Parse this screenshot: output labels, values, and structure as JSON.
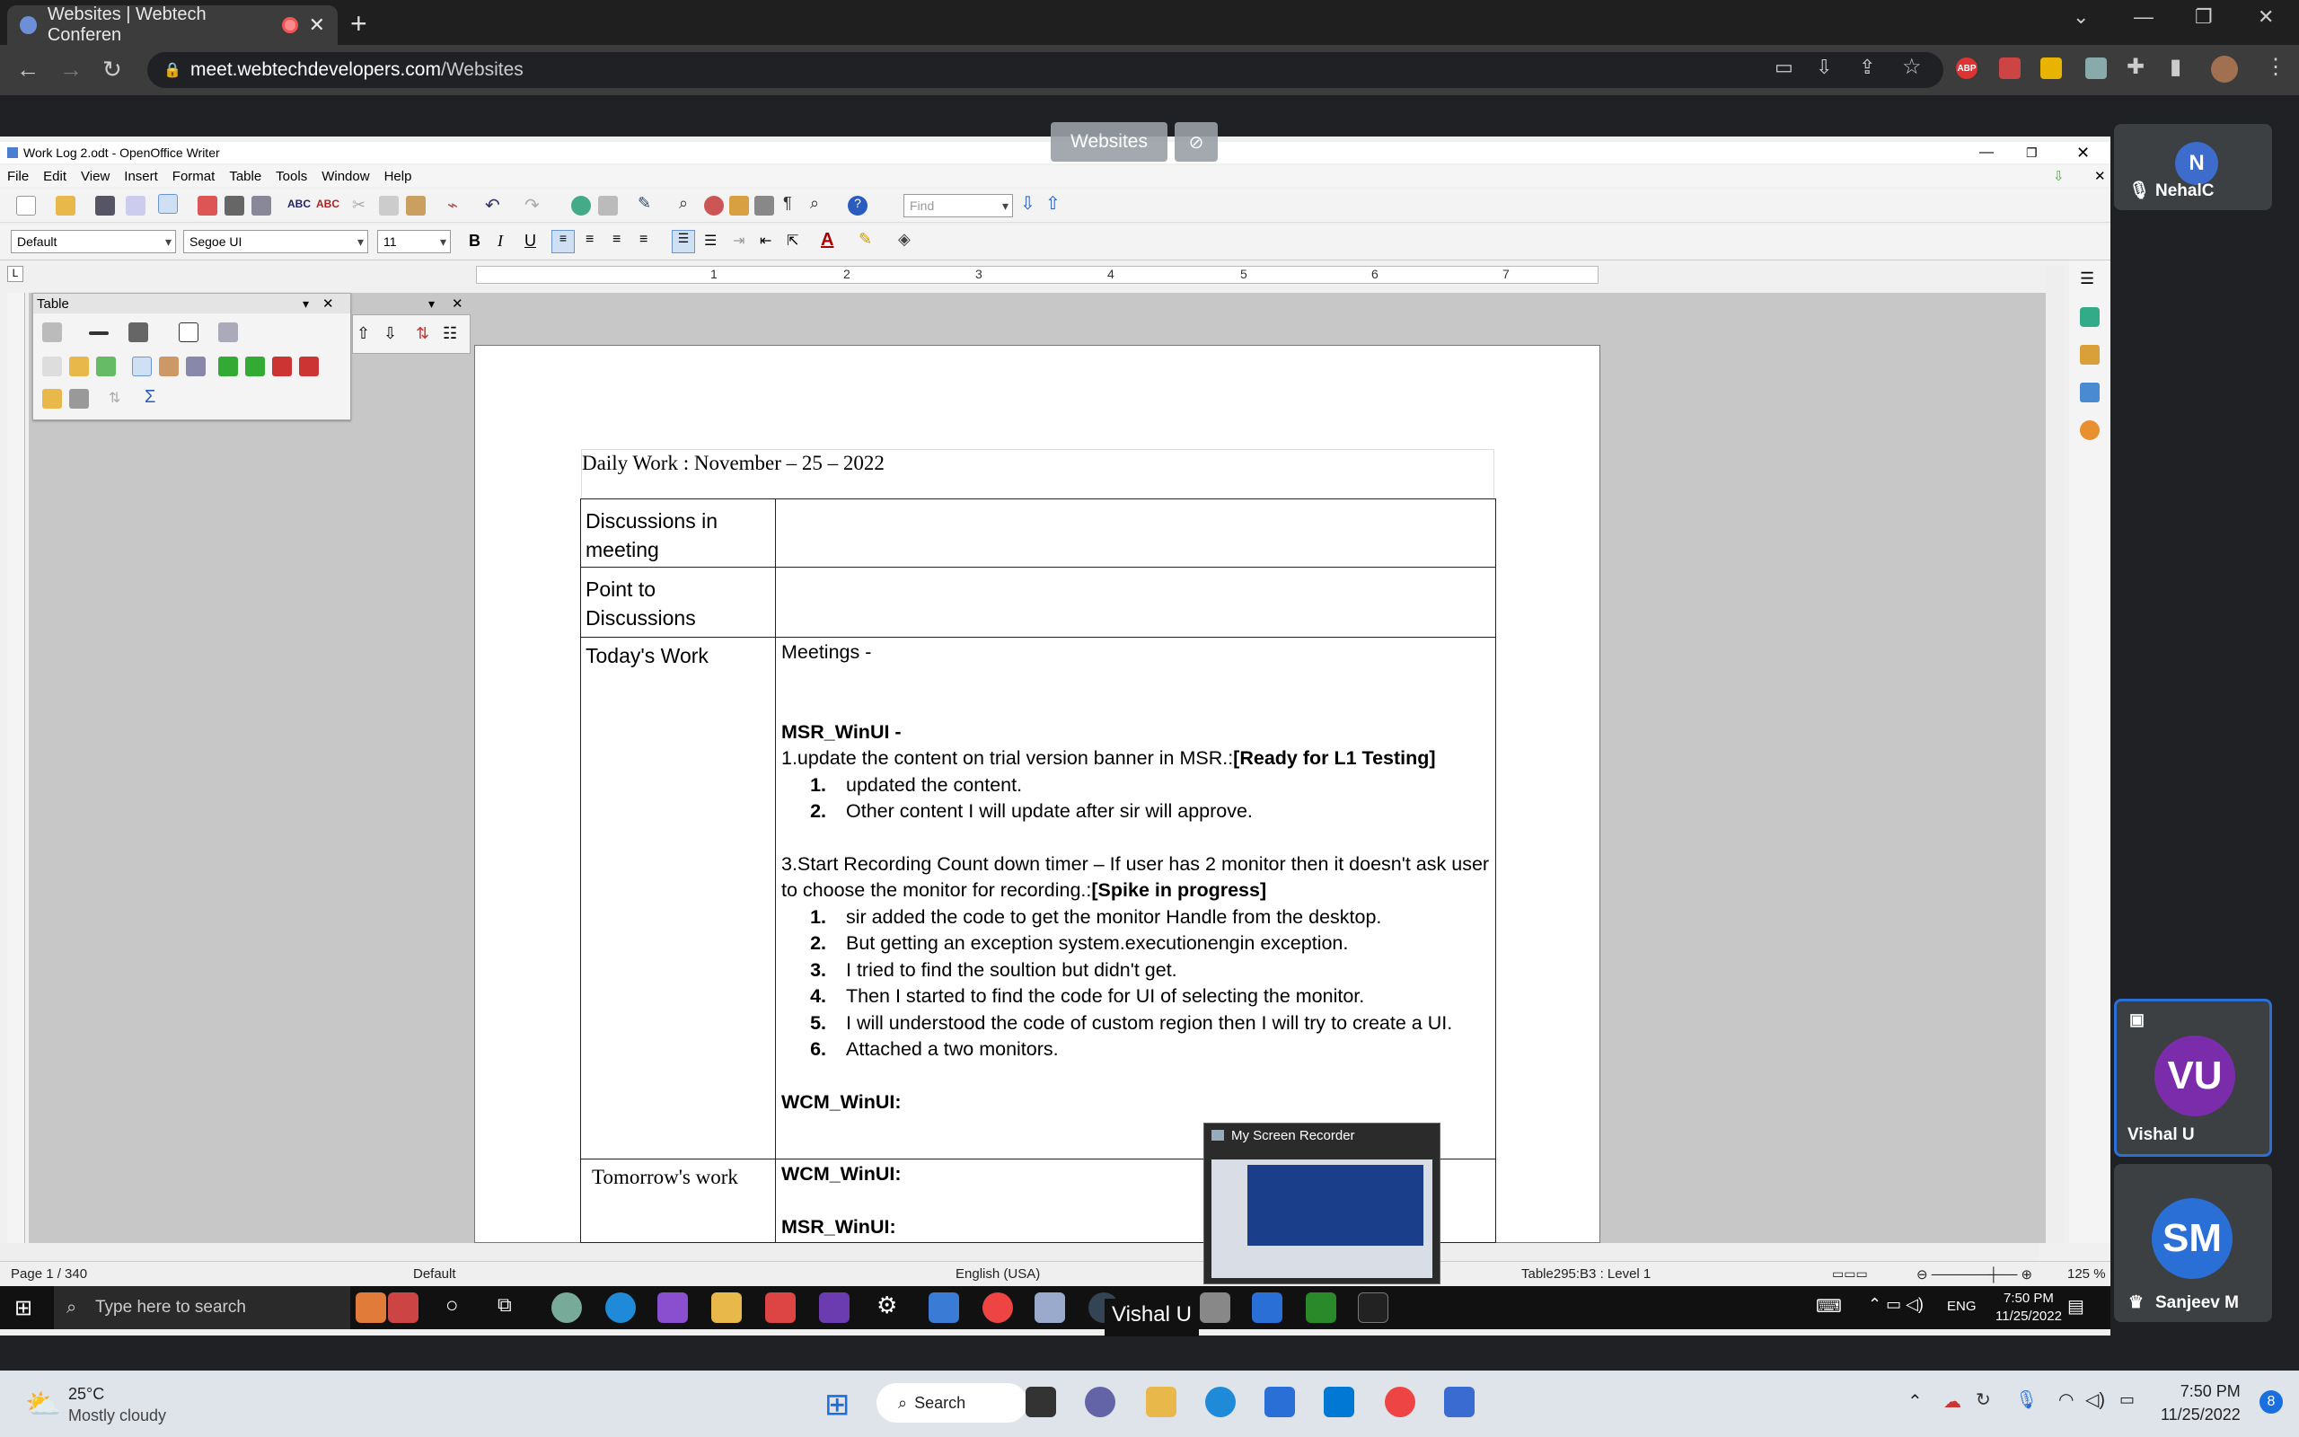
{
  "browser": {
    "tab_title": "Websites | Webtech Conferen",
    "url_host": "meet.webtechdevelopers.com",
    "url_path": "/Websites"
  },
  "meet": {
    "presenting_label": "Websites",
    "participants": [
      {
        "initials": "N",
        "name": "NehalC",
        "color": "#3e6ccd"
      },
      {
        "initials": "VU",
        "name": "Vishal U",
        "color": "#7b2cab"
      },
      {
        "initials": "SM",
        "name": "Sanjeev M",
        "color": "#2a6fd6"
      }
    ],
    "speaker_caption": "Vishal U"
  },
  "writer": {
    "window_title": "Work Log 2.odt - OpenOffice Writer",
    "menu": [
      "File",
      "Edit",
      "View",
      "Insert",
      "Format",
      "Table",
      "Tools",
      "Window",
      "Help"
    ],
    "find_placeholder": "Find",
    "paragraph_style": "Default",
    "font_name": "Segoe UI",
    "font_size": "11",
    "ruler_numbers": [
      "1",
      "2",
      "3",
      "4",
      "5",
      "6",
      "7"
    ],
    "table_toolbar_title": "Table",
    "status": {
      "page": "Page 1 / 340",
      "style": "Default",
      "language": "English (USA)",
      "cell": "Table295:B3 : Level 1",
      "zoom": "125 %"
    }
  },
  "document": {
    "title": "Daily Work : November – 25 – 2022",
    "rows": {
      "r1_label": "Discussions in meeting",
      "r2_label": "Point to Discussions",
      "r3_label": "Today's Work",
      "r4_label": "Tomorrow's work"
    },
    "meetings": "Meetings -",
    "msr_heading": "MSR_WinUI -",
    "item1_text": "1.update the content on  trial version banner in MSR.:",
    "item1_status": "[Ready for L1 Testing]",
    "item1_subs": [
      "updated the content.",
      "Other content I will update after sir will approve."
    ],
    "item3_text": "3.Start Recording Count down timer – If user has 2 monitor then it doesn't ask user to choose the monitor for recording.:",
    "item3_status": "[Spike in progress]",
    "item3_subs": [
      "sir added the code to get the monitor Handle from the desktop.",
      "But getting an exception system.executionengin exception.",
      "I tried to find the soultion but didn't get.",
      "Then I started to find the code for UI of selecting the monitor.",
      "I will understood the code of custom region then I will try to create a UI.",
      "Attached a two monitors."
    ],
    "wcm_heading": "WCM_WinUI:",
    "tomorrow_wcm": "WCM_WinUI:",
    "tomorrow_msr": "MSR_WinUI:"
  },
  "recorder": {
    "title": "My Screen Recorder"
  },
  "inner_taskbar": {
    "search_placeholder": "Type here to search",
    "lang": "ENG",
    "time": "7:50 PM",
    "date": "11/25/2022"
  },
  "outer_taskbar": {
    "temp": "25°C",
    "weather": "Mostly cloudy",
    "search": "Search",
    "time": "7:50 PM",
    "date": "11/25/2022",
    "notif_count": "8"
  }
}
